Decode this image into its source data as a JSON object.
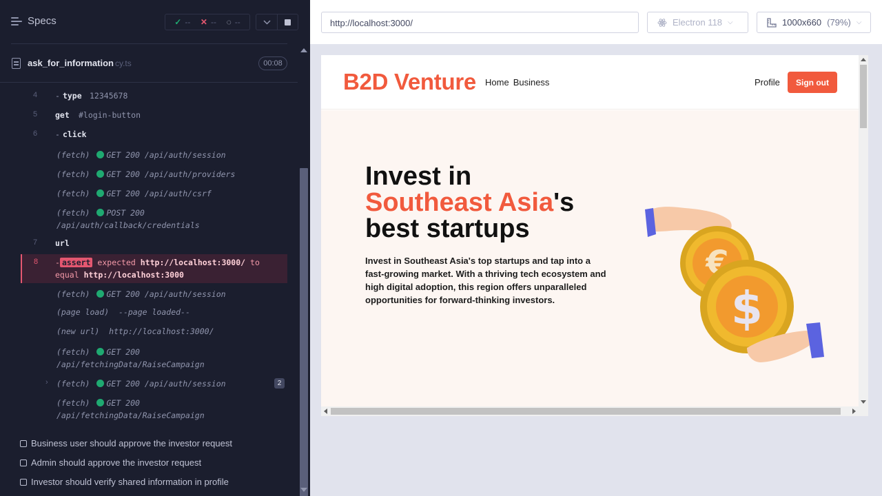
{
  "runner": {
    "title": "Specs",
    "stats": {
      "passed": "--",
      "failed": "--",
      "pending": "--"
    },
    "spec_file": {
      "name": "ask_for_information",
      "ext": "cy.ts",
      "duration": "00:08"
    },
    "commands": [
      {
        "num": "4",
        "name": "type",
        "child": true,
        "message": "12345678"
      },
      {
        "num": "5",
        "name": "get",
        "child": false,
        "message": "#login-button"
      },
      {
        "num": "6",
        "name": "click",
        "child": true,
        "message": ""
      }
    ],
    "events_a": [
      {
        "kind": "(fetch)",
        "text": "GET 200 /api/auth/session"
      },
      {
        "kind": "(fetch)",
        "text": "GET 200 /api/auth/providers"
      },
      {
        "kind": "(fetch)",
        "text": "GET 200 /api/auth/csrf"
      },
      {
        "kind": "(fetch)",
        "text": "POST 200",
        "text2": "/api/auth/callback/credentials"
      }
    ],
    "cmd_url": {
      "num": "7",
      "name": "url"
    },
    "failed_assert": {
      "num": "8",
      "chip": "assert",
      "word_expected": "expected",
      "actual": "http://localhost:3000/",
      "word_to": "to",
      "word_equal": "equal",
      "expected": "http://localhost:3000"
    },
    "events_b": [
      {
        "kind": "(fetch)",
        "text": "GET 200 /api/auth/session"
      },
      {
        "kind": "(page load)",
        "text": "--page loaded--"
      },
      {
        "kind": "(new url)",
        "text": "http://localhost:3000/"
      },
      {
        "kind": "(fetch)",
        "text": "GET 200",
        "text2": "/api/fetchingData/RaiseCampaign"
      },
      {
        "kind": "(fetch)",
        "text": "GET 200 /api/auth/session",
        "count": "2"
      },
      {
        "kind": "(fetch)",
        "text": "GET 200",
        "text2": "/api/fetchingData/RaiseCampaign"
      }
    ],
    "tests": [
      "Business user should approve the investor request",
      "Admin should approve the investor request",
      "Investor should verify shared information in profile"
    ]
  },
  "aut_header": {
    "url": "http://localhost:3000/",
    "browser": "Electron 118",
    "viewport": "1000x660",
    "zoom": "(79%)"
  },
  "app": {
    "brand": "B2D Venture",
    "nav": [
      "Home",
      "Business"
    ],
    "profile": "Profile",
    "signout": "Sign out",
    "hero": {
      "line1": "Invest in",
      "accent": "Southeast Asia",
      "after_accent": "'s",
      "line3": "best startups",
      "text": "Invest in Southeast Asia's top startups and tap into a fast-growing market. With a thriving tech ecosystem and high digital adoption, this region offers unparalleled opportunities for forward-thinking investors."
    },
    "colors": {
      "accent": "#f15a3d",
      "fail": "#e45770",
      "pass": "#1fa971"
    }
  }
}
